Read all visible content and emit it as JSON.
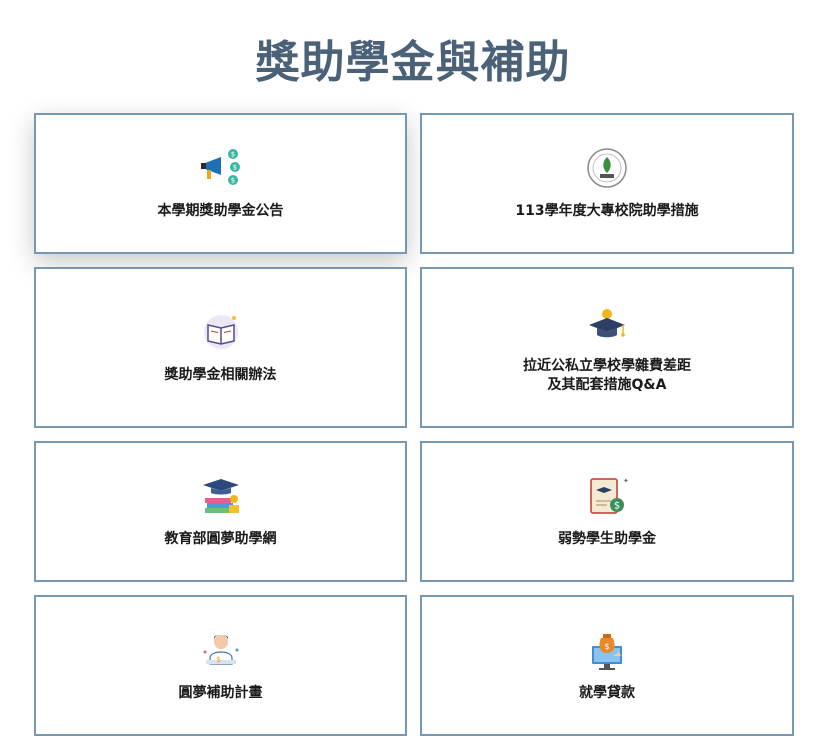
{
  "page": {
    "title": "獎助學金與補助"
  },
  "cards": [
    {
      "label": "本學期獎助學金公告",
      "icon": "megaphone-money-icon"
    },
    {
      "label": "113學年度大專校院助學措施",
      "icon": "ministry-of-education-logo-icon"
    },
    {
      "label": "獎助學金相關辦法",
      "icon": "open-book-icon"
    },
    {
      "label": "拉近公私立學校學雜費差距\n及其配套措施Q&A",
      "icon": "graduation-cap-coin-icon"
    },
    {
      "label": "教育部圓夢助學網",
      "icon": "graduation-books-coins-icon"
    },
    {
      "label": "弱勢學生助學金",
      "icon": "certificate-money-icon"
    },
    {
      "label": "圓夢補助計畫",
      "icon": "student-desk-icon"
    },
    {
      "label": "就學貸款",
      "icon": "money-bag-monitor-icon"
    }
  ],
  "colors": {
    "title": "#4a6178",
    "card_border": "#7698b3"
  }
}
